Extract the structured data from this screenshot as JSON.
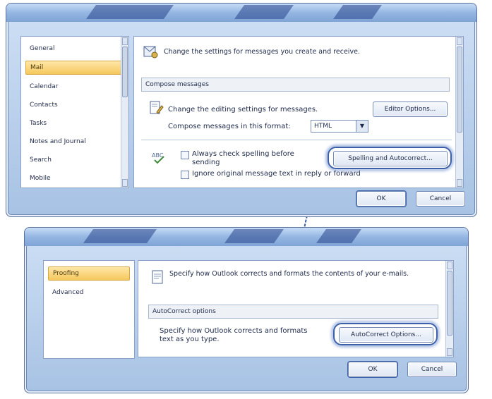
{
  "dialog_top": {
    "nav": [
      "General",
      "Mail",
      "Calendar",
      "Contacts",
      "Tasks",
      "Notes and Journal",
      "Search",
      "Mobile"
    ],
    "selected_index": 1,
    "header_text": "Change the settings for messages you create and receive.",
    "section_title": "Compose messages",
    "compose_text": "Change the editing settings for messages.",
    "compose_format_label": "Compose messages in this format:",
    "format_value": "HTML",
    "editor_button": "Editor Options...",
    "spell_check_label": "Always check spelling before sending",
    "ignore_original_label": "Ignore original message text in reply or forward",
    "spelling_button": "Spelling and Autocorrect...",
    "ok": "OK",
    "cancel": "Cancel"
  },
  "dialog_bottom": {
    "nav": [
      "Proofing",
      "Advanced"
    ],
    "selected_index": 0,
    "header_text": "Specify how Outlook corrects and formats the contents of your e-mails.",
    "section_title": "AutoCorrect options",
    "autocorrect_text": "Specify how Outlook corrects and formats text as you type.",
    "autocorrect_button": "AutoCorrect Options...",
    "ok": "OK",
    "cancel": "Cancel"
  },
  "colors": {
    "accent": "#3c5fa8",
    "selection": "#f5c85d"
  },
  "icons": {
    "header": "mail-settings-icon",
    "compose": "edit-document-icon",
    "spelling": "abc-spell-check-icon",
    "autocorrect": "document-icon"
  }
}
